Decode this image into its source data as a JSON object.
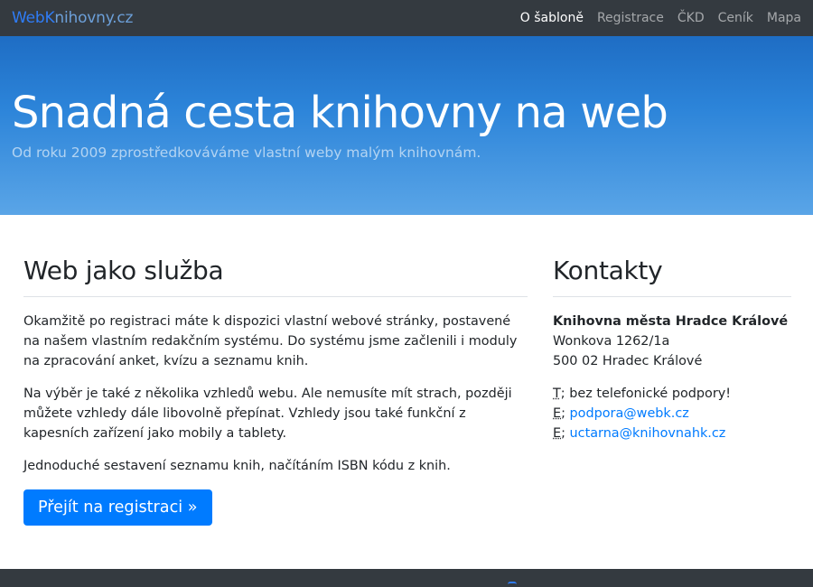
{
  "navbar": {
    "brand_part1": "Web",
    "brand_part2": "K",
    "brand_part3": "nihovny",
    "brand_part4": ".cz",
    "items": [
      {
        "label": "O šabloně",
        "active": true
      },
      {
        "label": "Registrace",
        "active": false
      },
      {
        "label": "ČKD",
        "active": false
      },
      {
        "label": "Ceník",
        "active": false
      },
      {
        "label": "Mapa",
        "active": false
      }
    ]
  },
  "hero": {
    "title": "Snadná cesta knihovny na web",
    "subtitle": "Od roku 2009 zprostředkováváme vlastní weby malým knihovnám."
  },
  "main": {
    "heading": "Web jako služba",
    "paragraphs": [
      "Okamžitě po registraci máte k dispozici vlastní webové stránky, postavené na našem vlastním redakčním systému. Do systému jsme začlenili i moduly na zpracování anket, kvízu a seznamu knih.",
      "Na výběr je také z několika vzhledů webu. Ale nemusíte mít strach, později můžete vzhledy dále libovolně přepínat. Vzhledy jsou také funkční z kapesních zařízení jako mobily a tablety.",
      "Jednoduché sestavení seznamu knih, načítáním ISBN kódu z knih."
    ],
    "button_label": "Přejít na registraci »"
  },
  "contacts": {
    "heading": "Kontakty",
    "org_name": "Knihovna města Hradce Králové",
    "street": "Wonkova 1262/1a",
    "city": "500 02 Hradec Králové",
    "phone_prefix": "T",
    "phone_text": "; bez telefonické podpory!",
    "email1_prefix": "E",
    "email1": "podpora@webk.cz",
    "email2_prefix": "E",
    "email2": "uctarna@knihovnahk.cz"
  },
  "colors": {
    "navbar_bg": "#343a40",
    "brand_blue": "#2f7cf6",
    "hero_top": "#1e6dc4",
    "hero_bottom": "#5aa5e7",
    "button_bg": "#007bff",
    "link": "#007bff"
  }
}
